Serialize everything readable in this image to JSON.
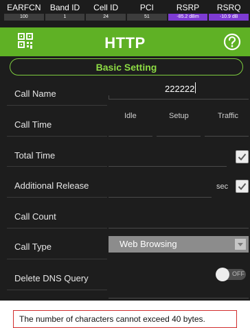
{
  "status_bar": {
    "cells": [
      {
        "label": "EARFCN",
        "value": "100"
      },
      {
        "label": "Band ID",
        "value": "1"
      },
      {
        "label": "Cell ID",
        "value": "24"
      },
      {
        "label": "PCI",
        "value": "51"
      },
      {
        "label": "RSRP",
        "value": "-85.2 dBm"
      },
      {
        "label": "RSRQ",
        "value": "-10.9 dB"
      }
    ],
    "highlight_color": "#7d3bd3"
  },
  "header": {
    "title": "HTTP",
    "left_icon": "qr-code-icon",
    "right_icon": "help-icon",
    "color": "#5fb125"
  },
  "section": {
    "title": "Basic Setting",
    "accent": "#8ddb44"
  },
  "form": {
    "call_name": {
      "label": "Call Name",
      "value": "222222"
    },
    "call_time": {
      "label": "Call Time",
      "columns": [
        "Idle",
        "Setup",
        "Traffic"
      ]
    },
    "total_time": {
      "label": "Total Time",
      "checked": true
    },
    "additional_release": {
      "label": "Additional Release",
      "unit": "sec",
      "checked": true
    },
    "call_count": {
      "label": "Call Count"
    },
    "call_type": {
      "label": "Call Type",
      "value": "Web Browsing"
    },
    "delete_dns_query": {
      "label": "Delete DNS Query",
      "toggle_text": "OFF",
      "on": false
    }
  },
  "toast": {
    "message": "The number of characters cannot exceed 40 bytes.",
    "border_color": "#d12b2b"
  }
}
